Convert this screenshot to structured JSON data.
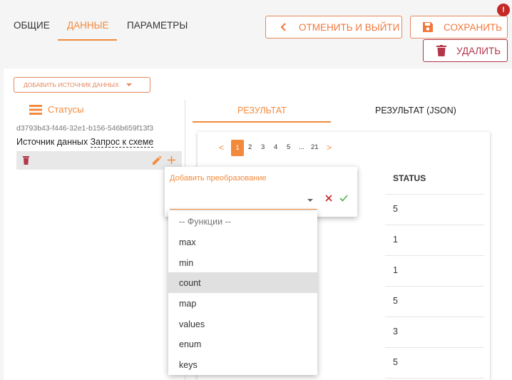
{
  "tabs": [
    {
      "label": "ОБЩИЕ",
      "active": false
    },
    {
      "label": "ДАННЫЕ",
      "active": true
    },
    {
      "label": "ПАРАМЕТРЫ",
      "active": false
    }
  ],
  "toolbar": {
    "cancel_label": "ОТМЕНИТЬ И ВЫЙТИ",
    "save_label": "СОХРАНИТЬ",
    "save_badge": "!",
    "delete_label": "УДАЛИТЬ"
  },
  "sources": {
    "add_label": "ДОБАВИТЬ ИСТОЧНИК ДАННЫХ",
    "title": "Статусы",
    "id": "d3793b43-f446-32e1-b156-546b659f13f3",
    "source_prefix": "Источник данных",
    "source_link": "Запрос к схеме"
  },
  "result_tabs": [
    {
      "label": "РЕЗУЛЬТАТ",
      "active": true
    },
    {
      "label": "РЕЗУЛЬТАТ (JSON)",
      "active": false
    }
  ],
  "pagination": {
    "prev": "<",
    "next": ">",
    "pages": [
      "1",
      "2",
      "3",
      "4",
      "5",
      "...",
      "21"
    ],
    "current": "1"
  },
  "table": {
    "header": "STATUS",
    "values": [
      "5",
      "1",
      "1",
      "5",
      "3",
      "5"
    ]
  },
  "transform": {
    "title": "Добавить преобразование",
    "value": ""
  },
  "functions": {
    "placeholder": "-- Функции --",
    "options": [
      "max",
      "min",
      "count",
      "map",
      "values",
      "enum",
      "keys"
    ],
    "highlighted": "count"
  },
  "colors": {
    "accent": "#f28a3c",
    "danger": "#b3364a",
    "confirm": "#4caf50"
  }
}
